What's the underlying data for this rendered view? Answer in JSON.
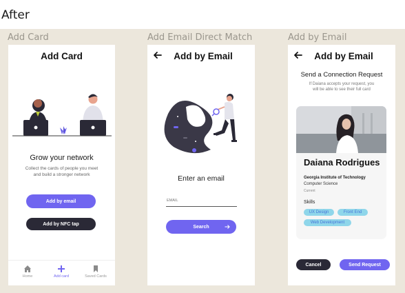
{
  "heading": "After",
  "frames": [
    {
      "title": "Add Card"
    },
    {
      "title": "Add Email Direct Match"
    },
    {
      "title": "Add by Email"
    }
  ],
  "add_card": {
    "header": "Add Card",
    "headline": "Grow your network",
    "description_line1": "Collect the cards of people you meet",
    "description_line2": "and build a stronger network",
    "email_button": "Add by email",
    "nfc_button": "Add by NFC tap",
    "tabs": [
      {
        "label": "Home",
        "icon": "home-icon"
      },
      {
        "label": "Add card",
        "icon": "plus-icon"
      },
      {
        "label": "Saved Cards",
        "icon": "bookmark-icon"
      }
    ]
  },
  "email_match": {
    "header": "Add by Email",
    "prompt": "Enter an email",
    "input_placeholder": "EMAIL",
    "search_button": "Search"
  },
  "add_by_email": {
    "header": "Add by Email",
    "title": "Send a Connection Request",
    "sub_line1": "If Daiana accepts your request, you",
    "sub_line2": "will be able to see their full card",
    "profile": {
      "name": "Daiana Rodrigues",
      "school": "Georgia Institute of Technology",
      "major": "Computer Science",
      "status": "Current",
      "skills_label": "Skills",
      "skills": [
        "UX Design",
        "Front End",
        "Web Development"
      ]
    },
    "cancel_button": "Cancel",
    "send_button": "Send Request"
  },
  "colors": {
    "accent": "#7065f0",
    "dark": "#2a2936",
    "chip": "#8fd6ea",
    "canvas": "#ece7dc"
  }
}
